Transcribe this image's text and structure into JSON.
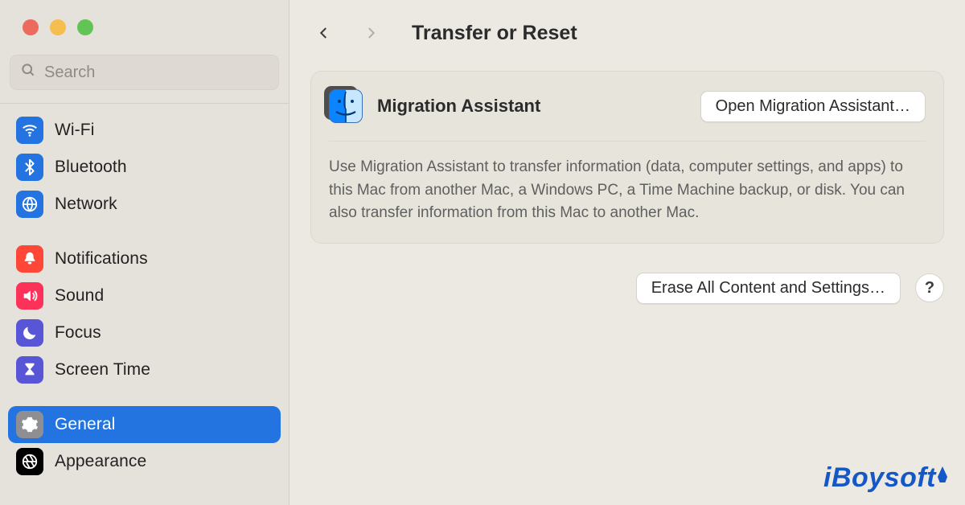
{
  "search": {
    "placeholder": "Search",
    "value": ""
  },
  "sidebar": {
    "groups": [
      [
        {
          "label": "Wi-Fi",
          "icon": "wifi-icon",
          "color": "blue",
          "selected": false
        },
        {
          "label": "Bluetooth",
          "icon": "bluetooth-icon",
          "color": "blue",
          "selected": false
        },
        {
          "label": "Network",
          "icon": "globe-icon",
          "color": "blue",
          "selected": false
        }
      ],
      [
        {
          "label": "Notifications",
          "icon": "bell-icon",
          "color": "red",
          "selected": false
        },
        {
          "label": "Sound",
          "icon": "speaker-icon",
          "color": "pink",
          "selected": false
        },
        {
          "label": "Focus",
          "icon": "moon-icon",
          "color": "indigo",
          "selected": false
        },
        {
          "label": "Screen Time",
          "icon": "hourglass-icon",
          "color": "indigo",
          "selected": false
        }
      ],
      [
        {
          "label": "General",
          "icon": "gear-icon",
          "color": "gray",
          "selected": true
        },
        {
          "label": "Appearance",
          "icon": "aperture-icon",
          "color": "black",
          "selected": false
        }
      ]
    ]
  },
  "header": {
    "title": "Transfer or Reset"
  },
  "card": {
    "title": "Migration Assistant",
    "open_button": "Open Migration Assistant…",
    "description": "Use Migration Assistant to transfer information (data, computer settings, and apps) to this Mac from another Mac, a Windows PC, a Time Machine backup, or disk. You can also transfer information from this Mac to another Mac."
  },
  "actions": {
    "erase_button": "Erase All Content and Settings…",
    "help": "?"
  },
  "watermark": "iBoysoft"
}
